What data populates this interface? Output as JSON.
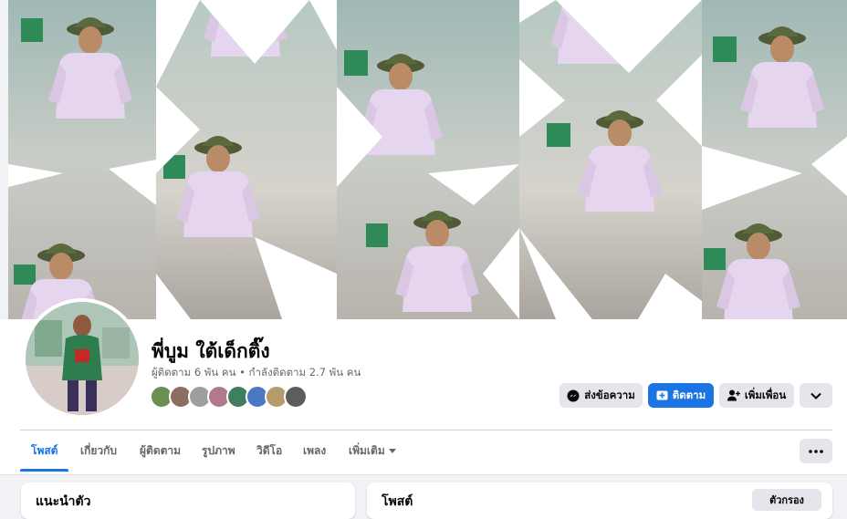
{
  "profile": {
    "name": "พี่บูม ใต้เด็กติ๊ง",
    "followers_text": "ผู้ติดตาม 6 พัน คน • กำลังติดตาม 2.7 พัน คน"
  },
  "friends": [
    {
      "color": "#6b8f4e"
    },
    {
      "color": "#8d6e63"
    },
    {
      "color": "#9e9e9e"
    },
    {
      "color": "#b07a8c"
    },
    {
      "color": "#3f7f5f"
    },
    {
      "color": "#4a78c2"
    },
    {
      "color": "#b59a6a"
    },
    {
      "color": "#5d5d5d"
    }
  ],
  "actions": {
    "message_label": "ส่งข้อความ",
    "follow_label": "ติดตาม",
    "add_friend_label": "เพิ่มเพื่อน"
  },
  "tabs": [
    {
      "label": "โพสต์"
    },
    {
      "label": "เกี่ยวกับ"
    },
    {
      "label": "ผู้ติดตาม"
    },
    {
      "label": "รูปภาพ"
    },
    {
      "label": "วิดีโอ"
    },
    {
      "label": "เพลง"
    },
    {
      "label": "เพิ่มเติม"
    }
  ],
  "cards": {
    "left_title": "แนะนำตัว",
    "right_title": "โพสต์",
    "right_button": "ตัวกรอง"
  },
  "colors": {
    "accent": "#1b74e4",
    "button_gray": "#e4e6eb",
    "page_bg": "#f0f2f5"
  }
}
